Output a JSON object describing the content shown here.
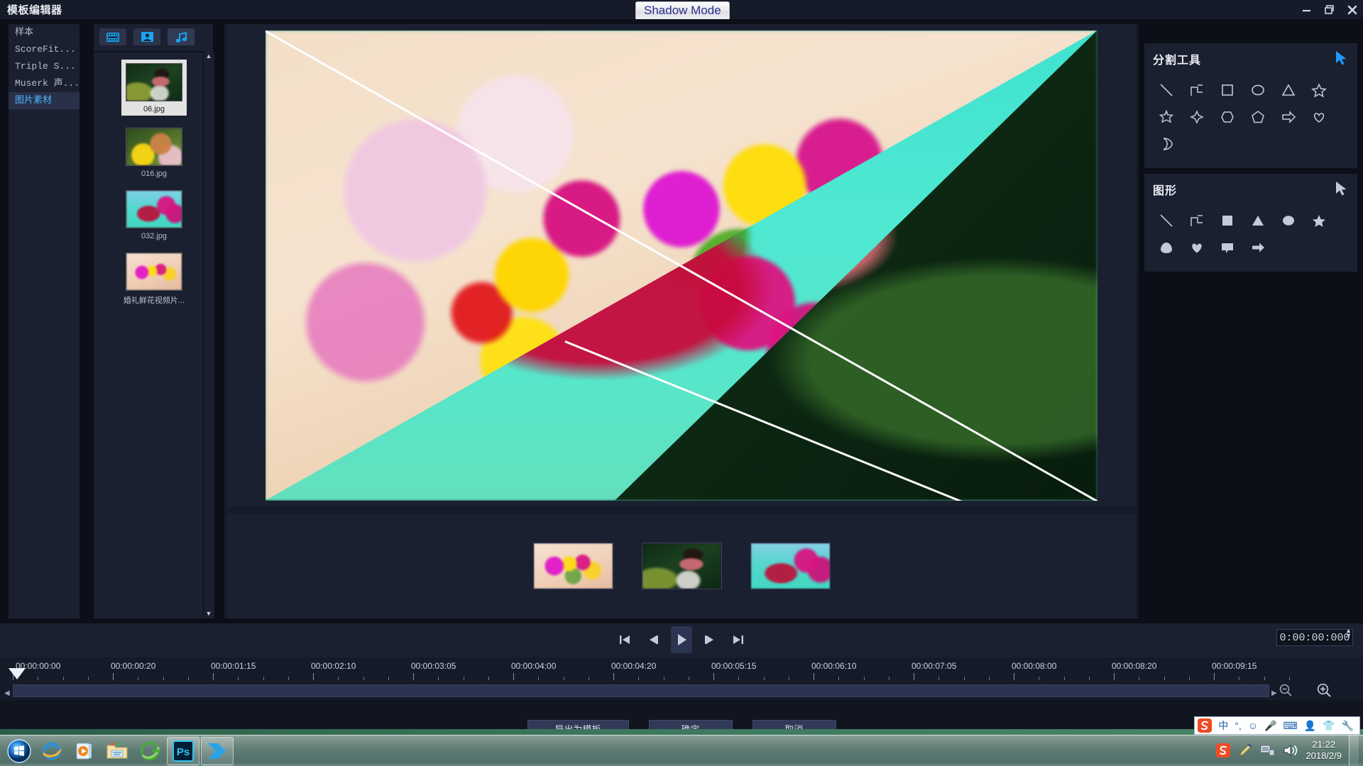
{
  "window": {
    "title": "模板编辑器",
    "mode_badge": "Shadow Mode",
    "controls": {
      "minimize": "minimize-icon",
      "restore": "restore-icon",
      "close": "close-icon"
    }
  },
  "categories": {
    "items": [
      {
        "label": "样本",
        "selected": false
      },
      {
        "label": "ScoreFit...",
        "selected": false
      },
      {
        "label": "Triple S...",
        "selected": false
      },
      {
        "label": "Muserk 声...",
        "selected": false
      },
      {
        "label": "图片素材",
        "selected": true
      }
    ]
  },
  "media_panel": {
    "tabs": [
      {
        "name": "video-tab",
        "icon": "film-icon",
        "active": false
      },
      {
        "name": "image-tab",
        "icon": "photo-icon",
        "active": false
      },
      {
        "name": "audio-tab",
        "icon": "music-note-icon",
        "active": true
      }
    ],
    "items": [
      {
        "label": "06.jpg",
        "selected": true
      },
      {
        "label": "016.jpg",
        "selected": false
      },
      {
        "label": "032.jpg",
        "selected": false
      },
      {
        "label": "婚礼鲜花视频片...",
        "selected": false
      }
    ]
  },
  "split_tools": {
    "title": "分割工具",
    "cursor_icon": "cursor-arrow-icon",
    "cursor_color": "#1e9bff",
    "shapes": [
      "line-icon",
      "polyline-icon",
      "square-outline-icon",
      "circle-outline-icon",
      "triangle-outline-icon",
      "star5-outline-icon",
      "star6-outline-icon",
      "sparkle-outline-icon",
      "hexagon-outline-icon",
      "pentagon-outline-icon",
      "arrow-right-outline-icon",
      "heart-outline-icon",
      "moon-outline-icon"
    ]
  },
  "shape_tools": {
    "title": "图形",
    "cursor_icon": "cursor-arrow-icon",
    "cursor_color": "#c3c9d8",
    "shapes": [
      "line-icon",
      "polyline-icon",
      "square-filled-icon",
      "triangle-filled-icon",
      "circle-filled-icon",
      "star5-filled-icon",
      "egg-filled-icon",
      "heart-filled-icon",
      "callout-filled-icon",
      "arrow-right-filled-icon"
    ]
  },
  "transport": {
    "buttons": [
      {
        "name": "jump-start-button",
        "icon": "skip-backward-icon",
        "active": false
      },
      {
        "name": "step-back-button",
        "icon": "step-backward-icon",
        "active": false
      },
      {
        "name": "play-button",
        "icon": "play-icon",
        "active": true
      },
      {
        "name": "step-forward-button",
        "icon": "step-forward-icon",
        "active": false
      },
      {
        "name": "jump-end-button",
        "icon": "skip-forward-icon",
        "active": false
      }
    ],
    "timecode": "0:00:00:000"
  },
  "timeline": {
    "labels": [
      "00:00:00:00",
      "00:00:00:20",
      "00:00:01:15",
      "00:00:02:10",
      "00:00:03:05",
      "00:00:04:00",
      "00:00:04:20",
      "00:00:05:15",
      "00:00:06:10",
      "00:00:07:05",
      "00:00:08:00",
      "00:00:08:20",
      "00:00:09:15"
    ],
    "zoom_out_icon": "zoom-out-icon",
    "zoom_in_icon": "zoom-in-icon"
  },
  "dialog_actions": {
    "export_template": "导出为模板",
    "confirm": "确定",
    "cancel": "取消"
  },
  "taskbar": {
    "start": "windows-start-orb-icon",
    "items": [
      {
        "name": "internet-explorer-icon",
        "pinned": false
      },
      {
        "name": "media-player-icon",
        "pinned": false
      },
      {
        "name": "file-explorer-icon",
        "pinned": false
      },
      {
        "name": "green-browser-icon",
        "pinned": false
      },
      {
        "name": "photoshop-icon",
        "pinned": true,
        "label": "Ps"
      },
      {
        "name": "video-editor-icon",
        "pinned": true
      }
    ],
    "ime": {
      "logo": "sogou-pinyin-icon",
      "glyphs": [
        "中",
        "°,",
        "☺",
        "🎤",
        "⌨",
        "👤",
        "👕",
        "🔧"
      ]
    },
    "tray": {
      "icons": [
        "sogou-tray-icon",
        "pen-tray-icon",
        "network-tray-icon",
        "volume-tray-icon"
      ],
      "time": "21:22",
      "date": "2018/2/9"
    }
  }
}
